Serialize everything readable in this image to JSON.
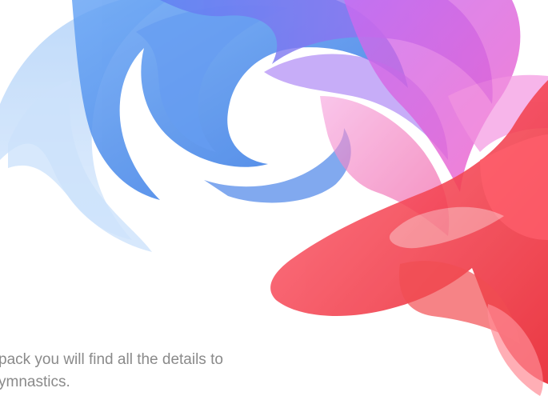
{
  "caption": {
    "line1": "pack you will find all the details to",
    "line2": "ymnastics."
  },
  "colors": {
    "background": "#ffffff",
    "caption_text": "#8a8a8a",
    "blue_ribbon": "#3f8cf0",
    "light_blue_ribbon": "#9cc6f7",
    "purple_ribbon": "#8a6bf0",
    "magenta_ribbon": "#e85fe0",
    "red_ribbon": "#f0343a"
  }
}
